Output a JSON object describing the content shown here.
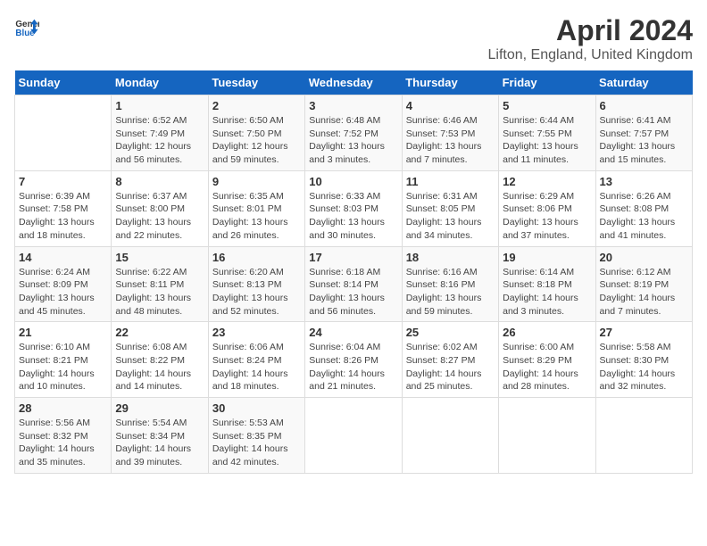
{
  "header": {
    "logo_general": "General",
    "logo_blue": "Blue",
    "title": "April 2024",
    "subtitle": "Lifton, England, United Kingdom"
  },
  "days_of_week": [
    "Sunday",
    "Monday",
    "Tuesday",
    "Wednesday",
    "Thursday",
    "Friday",
    "Saturday"
  ],
  "weeks": [
    [
      {
        "num": "",
        "sunrise": "",
        "sunset": "",
        "daylight": ""
      },
      {
        "num": "1",
        "sunrise": "Sunrise: 6:52 AM",
        "sunset": "Sunset: 7:49 PM",
        "daylight": "Daylight: 12 hours and 56 minutes."
      },
      {
        "num": "2",
        "sunrise": "Sunrise: 6:50 AM",
        "sunset": "Sunset: 7:50 PM",
        "daylight": "Daylight: 12 hours and 59 minutes."
      },
      {
        "num": "3",
        "sunrise": "Sunrise: 6:48 AM",
        "sunset": "Sunset: 7:52 PM",
        "daylight": "Daylight: 13 hours and 3 minutes."
      },
      {
        "num": "4",
        "sunrise": "Sunrise: 6:46 AM",
        "sunset": "Sunset: 7:53 PM",
        "daylight": "Daylight: 13 hours and 7 minutes."
      },
      {
        "num": "5",
        "sunrise": "Sunrise: 6:44 AM",
        "sunset": "Sunset: 7:55 PM",
        "daylight": "Daylight: 13 hours and 11 minutes."
      },
      {
        "num": "6",
        "sunrise": "Sunrise: 6:41 AM",
        "sunset": "Sunset: 7:57 PM",
        "daylight": "Daylight: 13 hours and 15 minutes."
      }
    ],
    [
      {
        "num": "7",
        "sunrise": "Sunrise: 6:39 AM",
        "sunset": "Sunset: 7:58 PM",
        "daylight": "Daylight: 13 hours and 18 minutes."
      },
      {
        "num": "8",
        "sunrise": "Sunrise: 6:37 AM",
        "sunset": "Sunset: 8:00 PM",
        "daylight": "Daylight: 13 hours and 22 minutes."
      },
      {
        "num": "9",
        "sunrise": "Sunrise: 6:35 AM",
        "sunset": "Sunset: 8:01 PM",
        "daylight": "Daylight: 13 hours and 26 minutes."
      },
      {
        "num": "10",
        "sunrise": "Sunrise: 6:33 AM",
        "sunset": "Sunset: 8:03 PM",
        "daylight": "Daylight: 13 hours and 30 minutes."
      },
      {
        "num": "11",
        "sunrise": "Sunrise: 6:31 AM",
        "sunset": "Sunset: 8:05 PM",
        "daylight": "Daylight: 13 hours and 34 minutes."
      },
      {
        "num": "12",
        "sunrise": "Sunrise: 6:29 AM",
        "sunset": "Sunset: 8:06 PM",
        "daylight": "Daylight: 13 hours and 37 minutes."
      },
      {
        "num": "13",
        "sunrise": "Sunrise: 6:26 AM",
        "sunset": "Sunset: 8:08 PM",
        "daylight": "Daylight: 13 hours and 41 minutes."
      }
    ],
    [
      {
        "num": "14",
        "sunrise": "Sunrise: 6:24 AM",
        "sunset": "Sunset: 8:09 PM",
        "daylight": "Daylight: 13 hours and 45 minutes."
      },
      {
        "num": "15",
        "sunrise": "Sunrise: 6:22 AM",
        "sunset": "Sunset: 8:11 PM",
        "daylight": "Daylight: 13 hours and 48 minutes."
      },
      {
        "num": "16",
        "sunrise": "Sunrise: 6:20 AM",
        "sunset": "Sunset: 8:13 PM",
        "daylight": "Daylight: 13 hours and 52 minutes."
      },
      {
        "num": "17",
        "sunrise": "Sunrise: 6:18 AM",
        "sunset": "Sunset: 8:14 PM",
        "daylight": "Daylight: 13 hours and 56 minutes."
      },
      {
        "num": "18",
        "sunrise": "Sunrise: 6:16 AM",
        "sunset": "Sunset: 8:16 PM",
        "daylight": "Daylight: 13 hours and 59 minutes."
      },
      {
        "num": "19",
        "sunrise": "Sunrise: 6:14 AM",
        "sunset": "Sunset: 8:18 PM",
        "daylight": "Daylight: 14 hours and 3 minutes."
      },
      {
        "num": "20",
        "sunrise": "Sunrise: 6:12 AM",
        "sunset": "Sunset: 8:19 PM",
        "daylight": "Daylight: 14 hours and 7 minutes."
      }
    ],
    [
      {
        "num": "21",
        "sunrise": "Sunrise: 6:10 AM",
        "sunset": "Sunset: 8:21 PM",
        "daylight": "Daylight: 14 hours and 10 minutes."
      },
      {
        "num": "22",
        "sunrise": "Sunrise: 6:08 AM",
        "sunset": "Sunset: 8:22 PM",
        "daylight": "Daylight: 14 hours and 14 minutes."
      },
      {
        "num": "23",
        "sunrise": "Sunrise: 6:06 AM",
        "sunset": "Sunset: 8:24 PM",
        "daylight": "Daylight: 14 hours and 18 minutes."
      },
      {
        "num": "24",
        "sunrise": "Sunrise: 6:04 AM",
        "sunset": "Sunset: 8:26 PM",
        "daylight": "Daylight: 14 hours and 21 minutes."
      },
      {
        "num": "25",
        "sunrise": "Sunrise: 6:02 AM",
        "sunset": "Sunset: 8:27 PM",
        "daylight": "Daylight: 14 hours and 25 minutes."
      },
      {
        "num": "26",
        "sunrise": "Sunrise: 6:00 AM",
        "sunset": "Sunset: 8:29 PM",
        "daylight": "Daylight: 14 hours and 28 minutes."
      },
      {
        "num": "27",
        "sunrise": "Sunrise: 5:58 AM",
        "sunset": "Sunset: 8:30 PM",
        "daylight": "Daylight: 14 hours and 32 minutes."
      }
    ],
    [
      {
        "num": "28",
        "sunrise": "Sunrise: 5:56 AM",
        "sunset": "Sunset: 8:32 PM",
        "daylight": "Daylight: 14 hours and 35 minutes."
      },
      {
        "num": "29",
        "sunrise": "Sunrise: 5:54 AM",
        "sunset": "Sunset: 8:34 PM",
        "daylight": "Daylight: 14 hours and 39 minutes."
      },
      {
        "num": "30",
        "sunrise": "Sunrise: 5:53 AM",
        "sunset": "Sunset: 8:35 PM",
        "daylight": "Daylight: 14 hours and 42 minutes."
      },
      {
        "num": "",
        "sunrise": "",
        "sunset": "",
        "daylight": ""
      },
      {
        "num": "",
        "sunrise": "",
        "sunset": "",
        "daylight": ""
      },
      {
        "num": "",
        "sunrise": "",
        "sunset": "",
        "daylight": ""
      },
      {
        "num": "",
        "sunrise": "",
        "sunset": "",
        "daylight": ""
      }
    ]
  ]
}
